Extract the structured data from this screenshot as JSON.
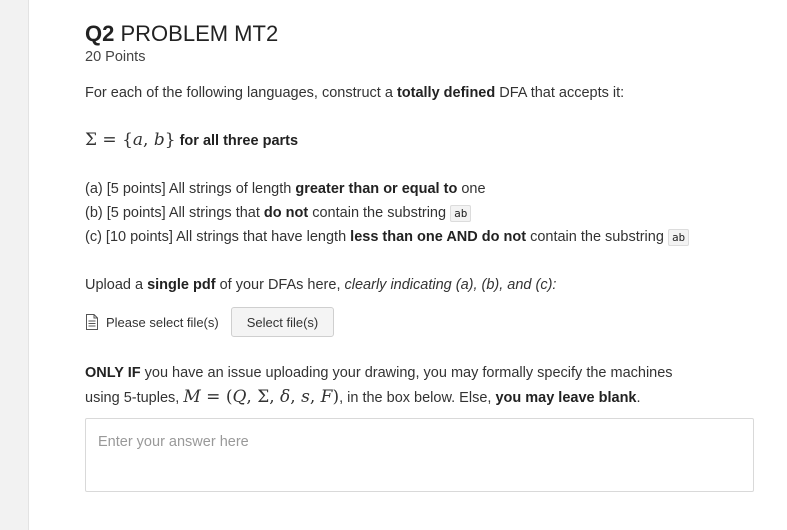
{
  "question": {
    "number": "Q2",
    "title": "PROBLEM MT2",
    "points": "20 Points"
  },
  "intro": {
    "pre": "For each of the following languages, construct a ",
    "bold": "totally defined",
    "post": " DFA that accepts it:"
  },
  "alphabet": {
    "math": "Σ = {a, b}",
    "bold_text": "for all three parts"
  },
  "parts": [
    {
      "pre": "(a) [5 points] All strings of length ",
      "bold": "greater than or equal to",
      "post": " one"
    },
    {
      "pre": "(b) [5 points] All strings that ",
      "bold": "do not",
      "post": " contain the substring ",
      "code": "ab"
    },
    {
      "pre": "(c) [10 points] All strings that have length ",
      "bold": "less than one AND do not",
      "post": " contain the substring ",
      "code": "ab"
    }
  ],
  "upload_instructions": {
    "pre": "Upload a ",
    "bold": "single pdf",
    "mid": " of your DFAs here, ",
    "italic": "clearly indicating (a), (b), and (c):"
  },
  "file_upload": {
    "label": "Please select file(s)",
    "button": "Select file(s)",
    "icon": "file-icon"
  },
  "fallback": {
    "bold1": "ONLY IF",
    "text1": " you have an issue uploading your drawing, you may formally specify the machines",
    "text2_pre": "using 5-tuples, ",
    "math": "M = (Q, Σ, δ, s, F)",
    "text2_post": ", in the box below.  Else, ",
    "bold2": "you may leave blank",
    "end": "."
  },
  "answer": {
    "placeholder": "Enter your answer here"
  }
}
